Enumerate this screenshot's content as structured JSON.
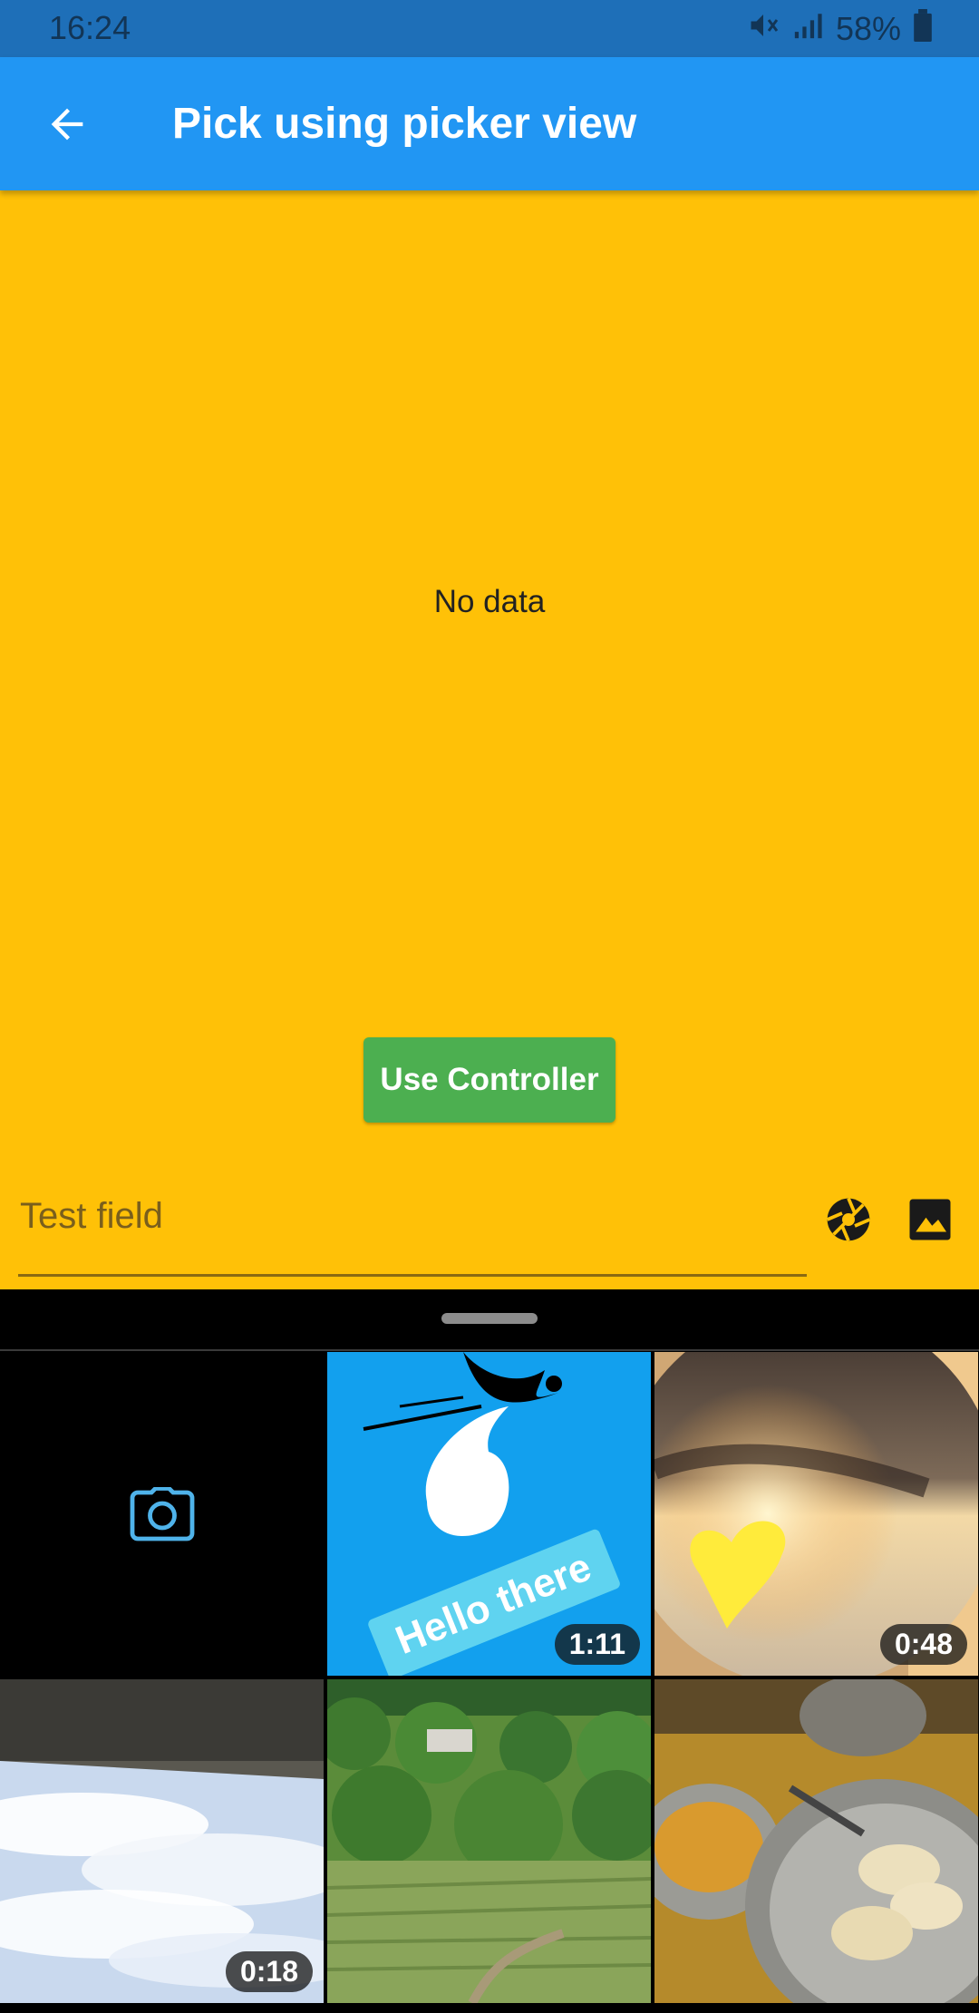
{
  "status": {
    "time": "16:24",
    "battery": "58%"
  },
  "appbar": {
    "title": "Pick using picker view",
    "back_icon": "arrow-back-icon"
  },
  "main": {
    "empty_text": "No data",
    "controller_button": "Use Controller"
  },
  "input": {
    "placeholder": "Test field",
    "camera_icon": "aperture-icon",
    "gallery_icon": "image-icon"
  },
  "picker": {
    "camera_icon": "camera-icon",
    "items": [
      {
        "type": "video",
        "duration": "1:11",
        "caption": "Hello there"
      },
      {
        "type": "video",
        "duration": "0:48"
      },
      {
        "type": "video",
        "duration": "0:18"
      },
      {
        "type": "image"
      },
      {
        "type": "image"
      }
    ]
  },
  "colors": {
    "appbar": "#2196f3",
    "content": "#ffc107",
    "button": "#4caf50",
    "camera_icon": "#4fb3ea"
  }
}
